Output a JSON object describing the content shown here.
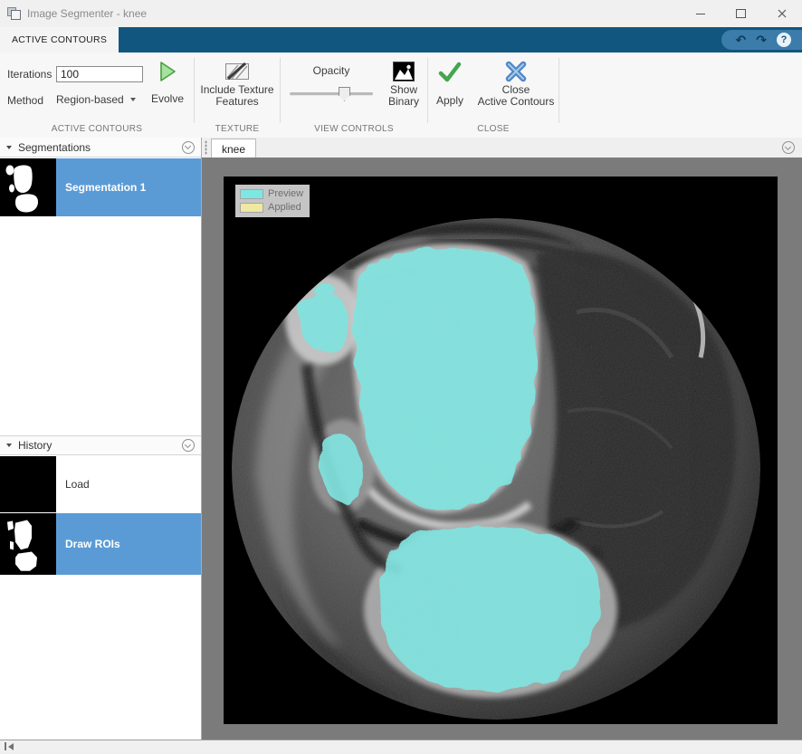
{
  "colors": {
    "preview_overlay": "#7CE8E4",
    "applied_overlay": "#EFE8A0",
    "selection_blue": "#5B9BD5",
    "toolstrip_blue": "#11567F",
    "canvas_gray": "#7B7B7B"
  },
  "icons": {
    "undo": "↶",
    "redo": "↷"
  },
  "window": {
    "title": "Image Segmenter - knee"
  },
  "toolstrip": {
    "tab_label": "ACTIVE CONTOURS",
    "help_label": "?",
    "groups": {
      "active_contours": {
        "iterations_label": "Iterations",
        "iterations_value": "100",
        "method_label": "Method",
        "method_value": "Region-based",
        "evolve_label": "Evolve",
        "section_label": "ACTIVE CONTOURS"
      },
      "texture": {
        "button_label_line1": "Include Texture",
        "button_label_line2": "Features",
        "section_label": "TEXTURE"
      },
      "view_controls": {
        "opacity_label": "Opacity",
        "show_binary_line1": "Show",
        "show_binary_line2": "Binary",
        "section_label": "VIEW CONTROLS"
      },
      "close": {
        "apply_label": "Apply",
        "close_line1": "Close",
        "close_line2": "Active Contours",
        "section_label": "CLOSE"
      }
    }
  },
  "sidebar": {
    "segmentations_panel": {
      "title": "Segmentations",
      "items": [
        {
          "label": "Segmentation 1",
          "selected": true
        }
      ]
    },
    "history_panel": {
      "title": "History",
      "items": [
        {
          "label": "Load",
          "selected": false
        },
        {
          "label": "Draw ROIs",
          "selected": true
        }
      ]
    }
  },
  "main": {
    "document_tab": "knee",
    "legend": {
      "preview_label": "Preview",
      "applied_label": "Applied"
    }
  }
}
